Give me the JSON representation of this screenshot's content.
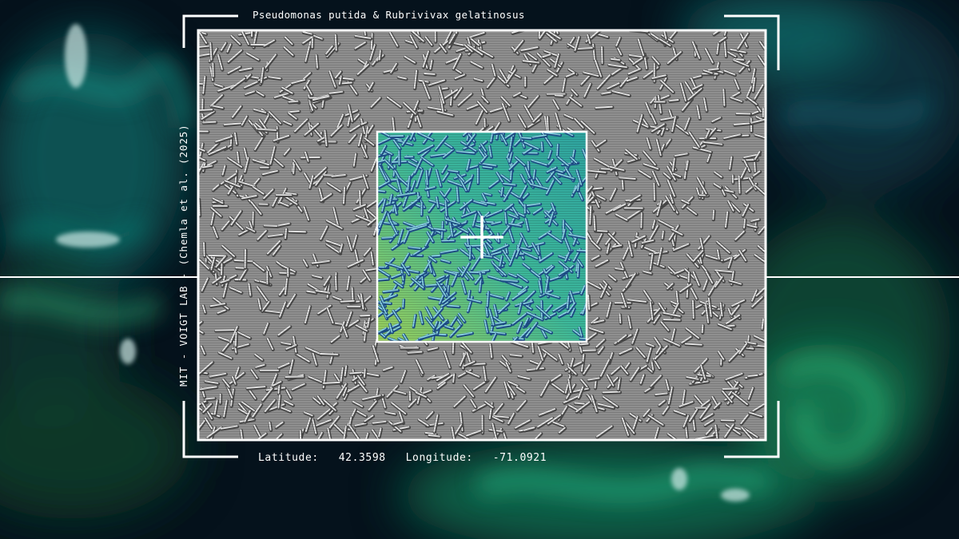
{
  "overlay": {
    "title": "Pseudomonas putida & Rubrivivax gelatinosus",
    "credit": "MIT - VOIGT LAB - (Chemla et al. (2025)",
    "latitude_label": "Latitude:",
    "latitude_value": "42.3598",
    "longitude_label": "Longitude:",
    "longitude_value": "-71.0921"
  },
  "colors": {
    "frame": "#ffffff",
    "highlight": "#3fbf9a",
    "background_teal": "#1a8f7a",
    "background_green": "#1f6a3a",
    "background_dark": "#05121c"
  },
  "icons": {
    "center_marker": "crosshair-icon",
    "corners": "corner-bracket-icon"
  }
}
